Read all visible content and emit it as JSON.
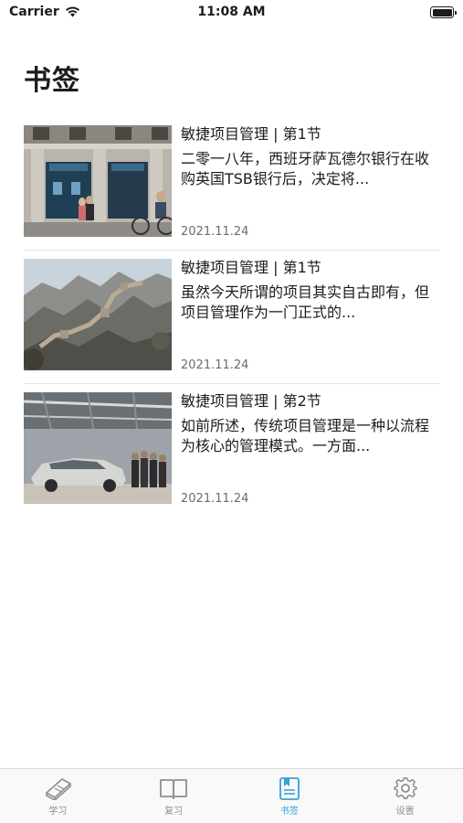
{
  "status_bar": {
    "carrier": "Carrier",
    "time": "11:08 AM"
  },
  "page_title": "书签",
  "bookmarks": [
    {
      "title": "敏捷项目管理 |  第1节",
      "excerpt": "二零一八年，西班牙萨瓦德尔银行在收购英国TSB银行后，决定将...",
      "date": "2021.11.24",
      "image": "bank-storefront-photo"
    },
    {
      "title": "敏捷项目管理 |  第1节",
      "excerpt": "虽然今天所谓的项目其实自古即有，但项目管理作为一门正式的...",
      "date": "2021.11.24",
      "image": "great-wall-photo"
    },
    {
      "title": "敏捷项目管理 |  第2节",
      "excerpt": "如前所述，传统项目管理是一种以流程为核心的管理模式。一方面...",
      "date": "2021.11.24",
      "image": "car-factory-photo"
    }
  ],
  "tab_bar": {
    "tabs": [
      {
        "label": "学习",
        "icon": "notebook-icon"
      },
      {
        "label": "复习",
        "icon": "open-book-icon"
      },
      {
        "label": "书签",
        "icon": "bookmark-icon",
        "active": true
      },
      {
        "label": "设置",
        "icon": "gear-icon"
      }
    ]
  },
  "colors": {
    "accent": "#3aa0d8",
    "inactive": "#8e8e93",
    "text": "#1c1c1e"
  }
}
